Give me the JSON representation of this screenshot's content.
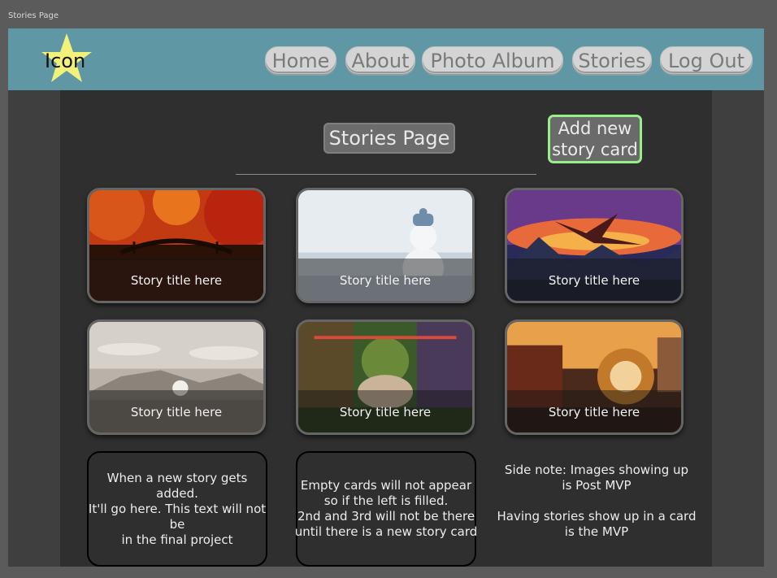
{
  "frame": {
    "label": "Stories Page"
  },
  "header": {
    "logo_text": "Icon",
    "nav": [
      "Home",
      "About",
      "Photo Album",
      "Stories",
      "Log Out"
    ]
  },
  "main": {
    "page_title": "Stories Page",
    "add_button": [
      "Add new",
      "story card"
    ],
    "cards": [
      {
        "title": "Story title here",
        "image": "autumn-bridge"
      },
      {
        "title": "Story title here",
        "image": "snowman"
      },
      {
        "title": "Story title here",
        "image": "dragon-sunset"
      },
      {
        "title": "Story title here",
        "image": "sketch-landscape"
      },
      {
        "title": "Story title here",
        "image": "fantasy-market"
      },
      {
        "title": "Story title here",
        "image": "steampunk-city"
      }
    ],
    "note_card_1": [
      "When a new story gets",
      "added.",
      "It'll go here. This text will not",
      "be",
      "in the final project"
    ],
    "note_card_2": [
      "Empty cards will not appear",
      "so if the left is filled.",
      "2nd and 3rd will not be there",
      "until there is a new story card"
    ],
    "side_note": [
      "Side note: Images showing up",
      "is Post MVP",
      "",
      "Having stories show up in a card",
      "is the MVP"
    ]
  }
}
